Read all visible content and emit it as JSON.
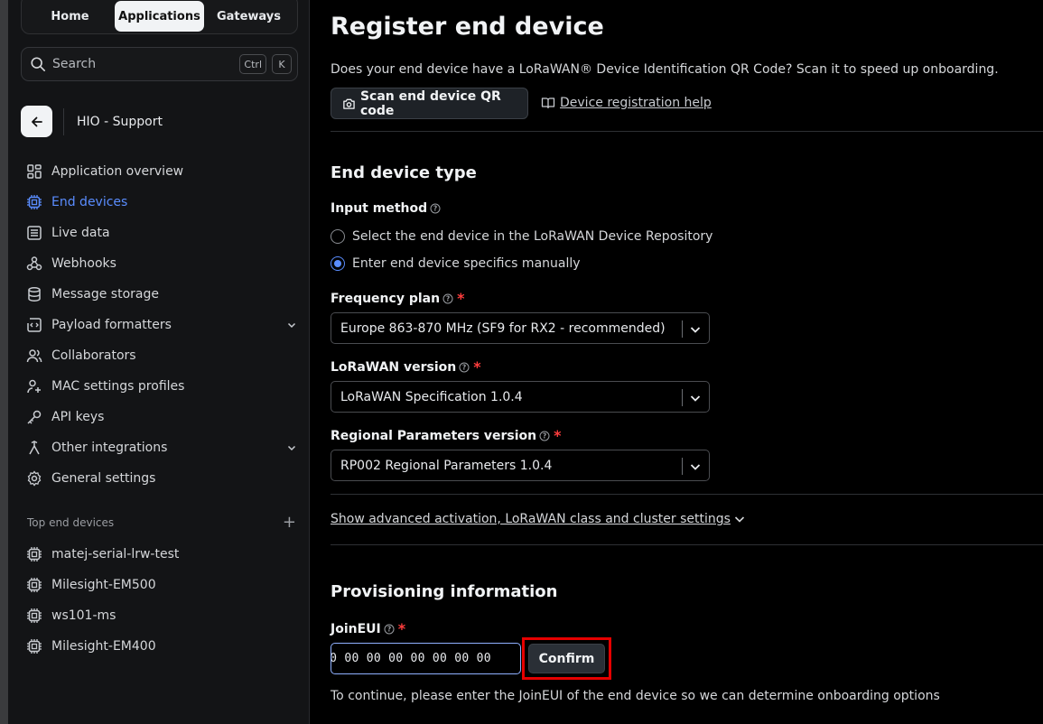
{
  "nav_tabs": [
    {
      "label": "Home",
      "active": false
    },
    {
      "label": "Applications",
      "active": true
    },
    {
      "label": "Gateways",
      "active": false
    }
  ],
  "search": {
    "placeholder": "Search",
    "shortcut_keys": [
      "Ctrl",
      "K"
    ]
  },
  "application": {
    "name": "HIO - Support"
  },
  "sidebar": {
    "items": [
      {
        "label": "Application overview",
        "icon": "dashboard-icon",
        "active": false
      },
      {
        "label": "End devices",
        "icon": "chip-icon",
        "active": true
      },
      {
        "label": "Live data",
        "icon": "list-icon",
        "active": false
      },
      {
        "label": "Webhooks",
        "icon": "webhook-icon",
        "active": false
      },
      {
        "label": "Message storage",
        "icon": "database-icon",
        "active": false
      },
      {
        "label": "Payload formatters",
        "icon": "code-icon",
        "active": false,
        "expandable": true
      },
      {
        "label": "Collaborators",
        "icon": "users-icon",
        "active": false
      },
      {
        "label": "MAC settings profiles",
        "icon": "user-plus-icon",
        "active": false
      },
      {
        "label": "API keys",
        "icon": "key-icon",
        "active": false
      },
      {
        "label": "Other integrations",
        "icon": "integrations-icon",
        "active": false,
        "expandable": true
      },
      {
        "label": "General settings",
        "icon": "gear-icon",
        "active": false
      }
    ],
    "top_devices_heading": "Top end devices",
    "top_devices": [
      "matej-serial-lrw-test",
      "Milesight-EM500",
      "ws101-ms",
      "Milesight-EM400"
    ]
  },
  "main": {
    "title": "Register end device",
    "subtitle": "Does your end device have a LoRaWAN® Device Identification QR Code? Scan it to speed up onboarding.",
    "scan_button": "Scan end device QR code",
    "help_link": "Device registration help",
    "device_type": {
      "heading": "End device type",
      "input_method_label": "Input method",
      "options": [
        {
          "label": "Select the end device in the LoRaWAN Device Repository",
          "checked": false
        },
        {
          "label": "Enter end device specifics manually",
          "checked": true
        }
      ],
      "frequency_plan_label": "Frequency plan",
      "frequency_plan_value": "Europe 863-870 MHz (SF9 for RX2 - recommended)",
      "lorawan_version_label": "LoRaWAN version",
      "lorawan_version_value": "LoRaWAN Specification 1.0.4",
      "regional_params_label": "Regional Parameters version",
      "regional_params_value": "RP002 Regional Parameters 1.0.4",
      "advanced_link": "Show advanced activation, LoRaWAN class and cluster settings"
    },
    "provisioning": {
      "heading": "Provisioning information",
      "joineui_label": "JoinEUI",
      "joineui_value": "00 00 00 00 00 00 00 00",
      "confirm_button": "Confirm",
      "hint": "To continue, please enter the JoinEUI of the end device so we can determine onboarding options"
    }
  },
  "colors": {
    "accent": "#5a8dff",
    "required": "#ff3d3d",
    "highlight_box": "#e60000",
    "background": "#000000",
    "sidebar": "#131416"
  }
}
